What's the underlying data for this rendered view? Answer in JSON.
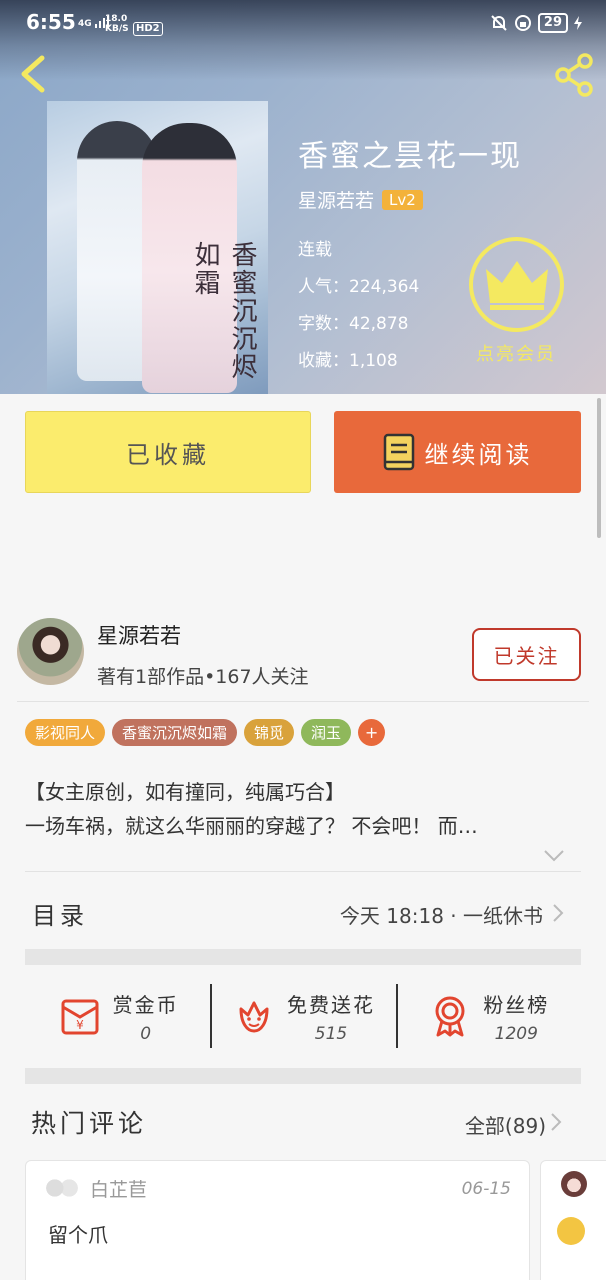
{
  "status_bar": {
    "time": "6:55",
    "network": "4G",
    "speed": "18.0",
    "speed_unit": "KB/S",
    "hd": "HD2",
    "battery": "29"
  },
  "book": {
    "title": "香蜜之昙花一现",
    "author": "星源若若",
    "level": "Lv2",
    "status": "连载",
    "popularity": "人气：224,364",
    "word_count": "字数：42,878",
    "favorites": "收藏：1,108",
    "cover_text": "香蜜沉沉烬如霜"
  },
  "vip": {
    "label": "点亮会员"
  },
  "actions": {
    "collected_label": "已收藏",
    "read_label": "继续阅读"
  },
  "author_section": {
    "name": "星源若若",
    "stats": "著有1部作品•167人关注",
    "follow_label": "已关注"
  },
  "tags": [
    {
      "label": "影视同人",
      "color": "#f1a93b"
    },
    {
      "label": "香蜜沉沉烬如霜",
      "color": "#c0725e"
    },
    {
      "label": "锦觅",
      "color": "#d9a23b"
    },
    {
      "label": "润玉",
      "color": "#8fb85b"
    }
  ],
  "tag_add": "+",
  "synopsis": {
    "line1": "【女主原创，如有撞同，纯属巧合】",
    "line2": "一场车祸，就这么华丽丽的穿越了？ 不会吧！ 而…"
  },
  "toc": {
    "label": "目录",
    "latest": "今天 18:18 · 一纸休书"
  },
  "stats": [
    {
      "label": "赏金币",
      "value": "0",
      "icon": "red-envelope-icon"
    },
    {
      "label": "免费送花",
      "value": "515",
      "icon": "flower-icon"
    },
    {
      "label": "粉丝榜",
      "value": "1209",
      "icon": "medal-icon"
    }
  ],
  "comments": {
    "title": "热门评论",
    "all_label": "全部(89)",
    "items": [
      {
        "user": "白芷苣",
        "date": "06-15",
        "text": "留个爪"
      }
    ]
  },
  "colors": {
    "accent_orange": "#e8693b",
    "collected_yellow": "#fbec6d",
    "vip_yellow": "#f4e960",
    "follow_red": "#c0392b"
  }
}
